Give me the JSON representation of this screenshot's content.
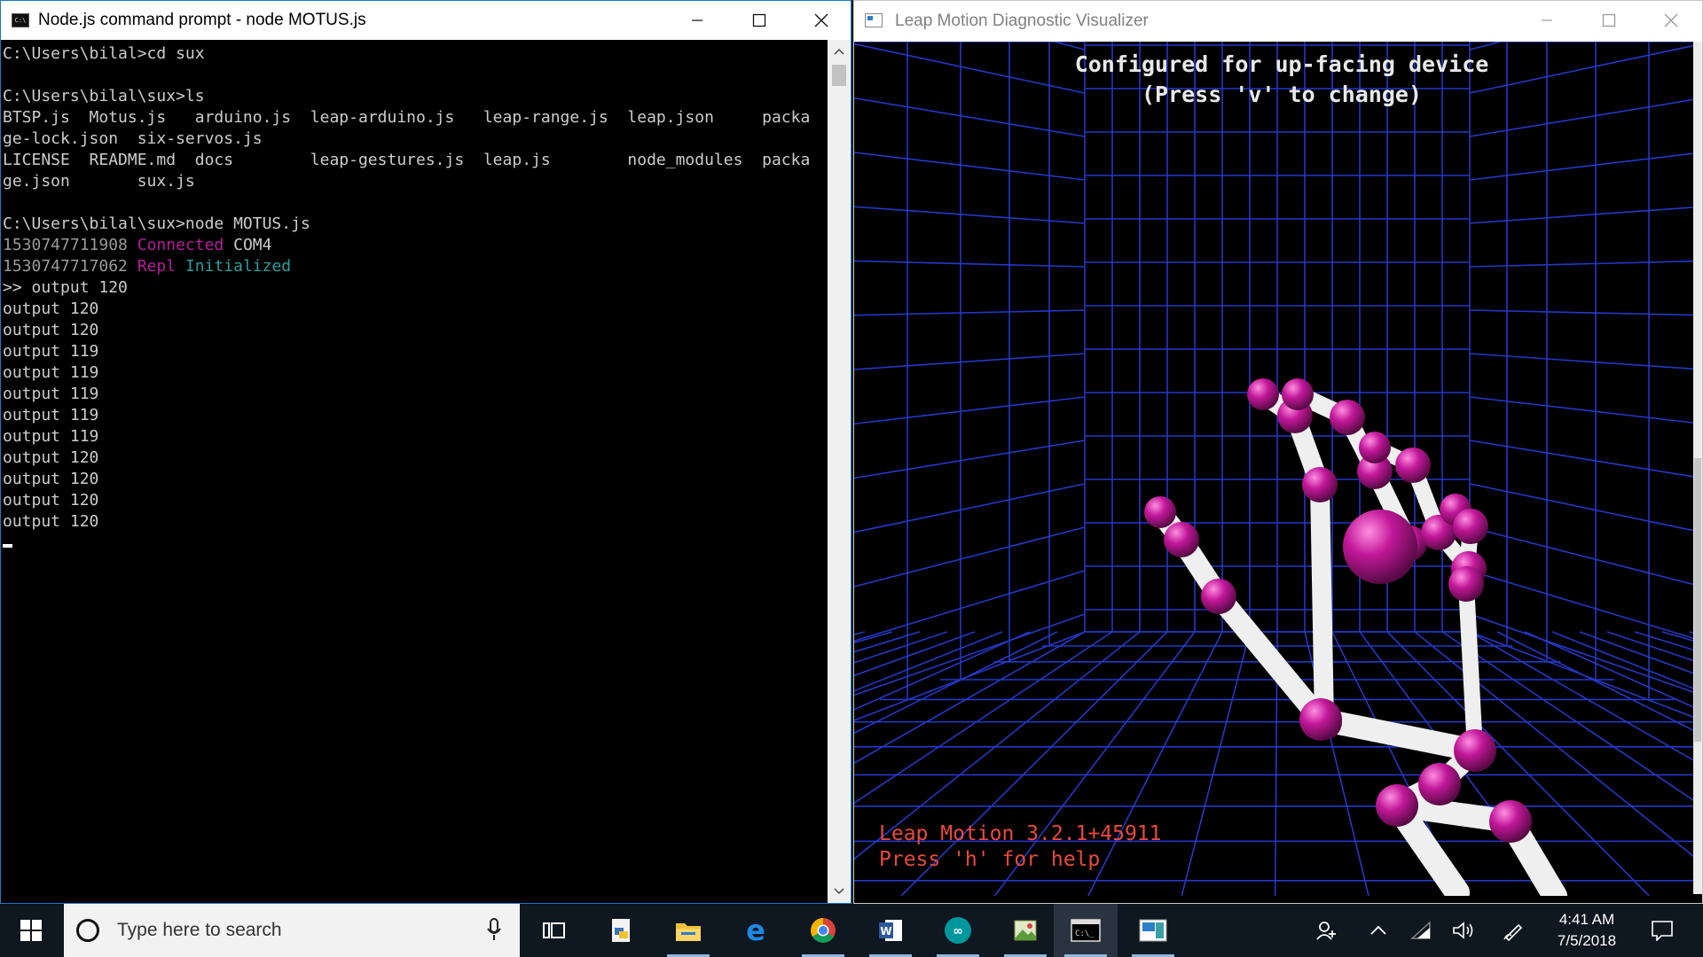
{
  "cmd": {
    "title": "Node.js command prompt - node  MOTUS.js",
    "icon": "console-icon",
    "lines_before": [
      "C:\\Users\\bilal>cd sux",
      "",
      "C:\\Users\\bilal\\sux>ls",
      "BTSP.js  Motus.js   arduino.js  leap-arduino.js   leap-range.js  leap.json     packa",
      "ge-lock.json  six-servos.js",
      "LICENSE  README.md  docs        leap-gestures.js  leap.js        node_modules  packa",
      "ge.json       sux.js",
      "",
      "C:\\Users\\bilal\\sux>node MOTUS.js"
    ],
    "log1": {
      "ts": "1530747711908",
      "word": "Connected",
      "rest": "COM4"
    },
    "log2": {
      "ts": "1530747717062",
      "word1": "Repl",
      "word2": "Initialized"
    },
    "lines_after": [
      ">> output 120",
      "output 120",
      "output 120",
      "output 119",
      "output 119",
      "output 119",
      "output 119",
      "output 119",
      "output 120",
      "output 120",
      "output 120",
      "output 120"
    ]
  },
  "leap": {
    "title": "Leap Motion Diagnostic Visualizer",
    "overlay_line1": "Configured for up-facing device",
    "overlay_line2": "(Press 'v' to change)",
    "version_line": "Leap Motion 3.2.1+45911",
    "help_line": "Press 'h' for help",
    "colors": {
      "grid": "#2438c8",
      "joint": "#c2189a",
      "bone": "#f0f0f0",
      "overlay_text": "#e8e8e8",
      "version_text": "#e84a3c"
    }
  },
  "taskbar": {
    "search_placeholder": "Type here to search",
    "time": "4:41 AM",
    "date": "7/5/2018",
    "apps": [
      "task-view-icon",
      "python-file-icon",
      "file-explorer-icon",
      "edge-icon",
      "chrome-icon",
      "word-icon",
      "arduino-icon",
      "image-editor-icon",
      "cmd-icon",
      "leap-visualizer-icon"
    ],
    "tray": [
      "people-icon",
      "chevron-up-icon",
      "wifi-icon",
      "volume-icon",
      "pen-icon",
      "notifications-icon"
    ]
  }
}
